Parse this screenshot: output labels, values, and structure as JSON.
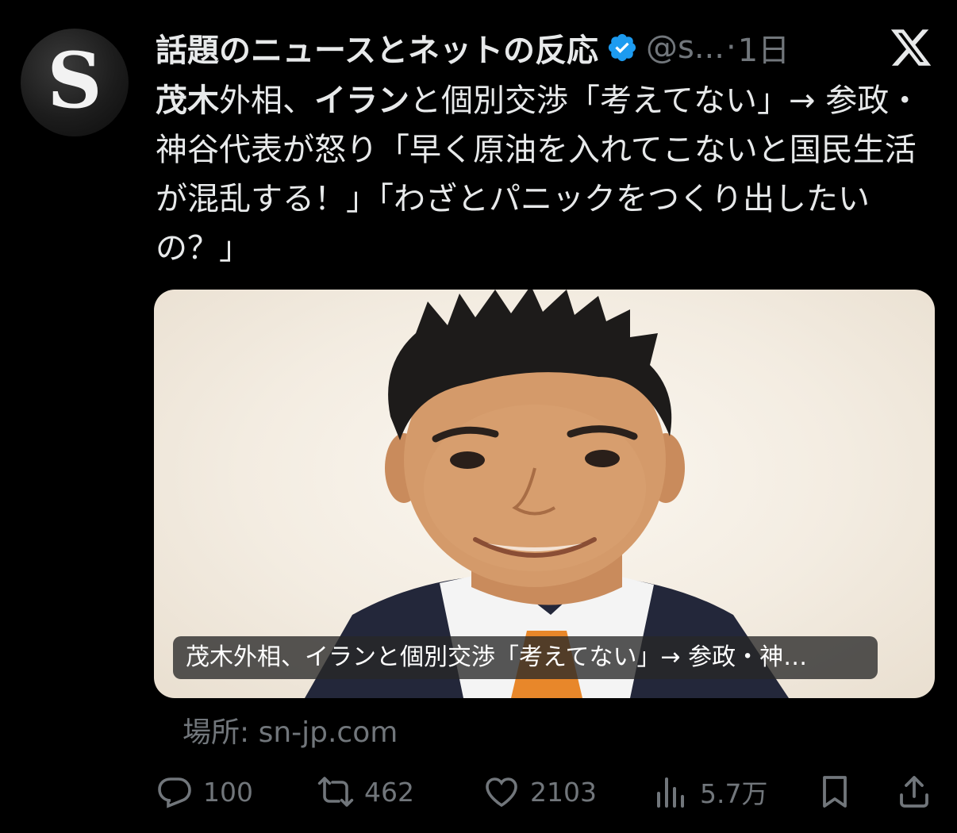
{
  "author": {
    "avatar_letter": "S",
    "display_name": "話題のニュースとネットの反応",
    "handle": "@s...",
    "separator": "·",
    "time": "1日"
  },
  "post": {
    "bold_prefix": "茂木",
    "text_1": "外相、",
    "bold_mid": "イラン",
    "text_2": "と個別交渉「考えてない」→ 参政・神谷代表が怒り「早く原油を入れてこないと国民生活が混乱する！」「わざとパニックをつくり出したいの？」"
  },
  "media": {
    "caption": "茂木外相、イランと個別交渉「考えてない」→ 参政・神…"
  },
  "source": "場所: sn-jp.com",
  "actions": {
    "replies": "100",
    "reposts": "462",
    "likes": "2103",
    "views": "5.7万"
  },
  "icons": [
    "verified-badge-icon",
    "x-logo-icon",
    "reply-icon",
    "repost-icon",
    "like-icon",
    "views-icon",
    "bookmark-icon",
    "share-icon"
  ],
  "colors": {
    "background": "#000000",
    "text": "#e7e9ea",
    "muted": "#71767b",
    "verified": "#1d9bf0"
  }
}
